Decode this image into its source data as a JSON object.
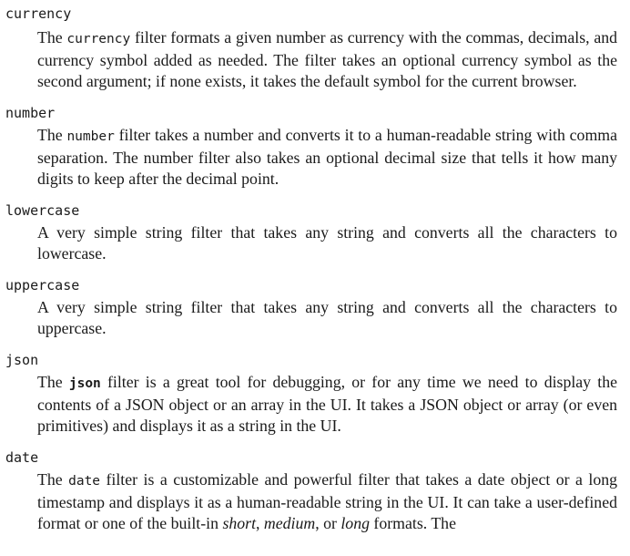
{
  "entries": [
    {
      "term": "currency",
      "desc": {
        "pre": "The ",
        "code": "currency",
        "post": " filter formats a given number as currency with the commas, decimals, and currency symbol added as needed. The filter takes an optional currency symbol as the second argument; if none exists, it takes the default symbol for the current browser."
      }
    },
    {
      "term": "number",
      "desc": {
        "pre": "The ",
        "code": "number",
        "post": " filter takes a number and converts it to a human-readable string with comma separation. The number filter also takes an optional decimal size that tells it how many digits to keep after the decimal point."
      }
    },
    {
      "term": "lowercase",
      "desc": {
        "text": "A very simple string filter that takes any string and converts all the characters to lowercase."
      }
    },
    {
      "term": "uppercase",
      "desc": {
        "text": "A very simple string filter that takes any string and converts all the characters to uppercase."
      }
    },
    {
      "term": "json",
      "desc": {
        "pre": "The ",
        "code": "json",
        "post": " filter is a great tool for debugging, or for any time we need to display the contents of a JSON object or an array in the UI. It takes a JSON object or array (or even primitives) and displays it as a string in the UI."
      }
    },
    {
      "term": "date",
      "desc": {
        "pre": "The ",
        "code": "date",
        "post": " filter is a customizable and powerful filter that takes a date object or a long timestamp and displays it as a human-readable string in the UI. It can take a user-defined format or one of the built-in ",
        "em1": "short",
        "sep1": ", ",
        "em2": "medium",
        "sep2": ", or ",
        "em3": "long",
        "tail": " formats. The"
      }
    }
  ]
}
